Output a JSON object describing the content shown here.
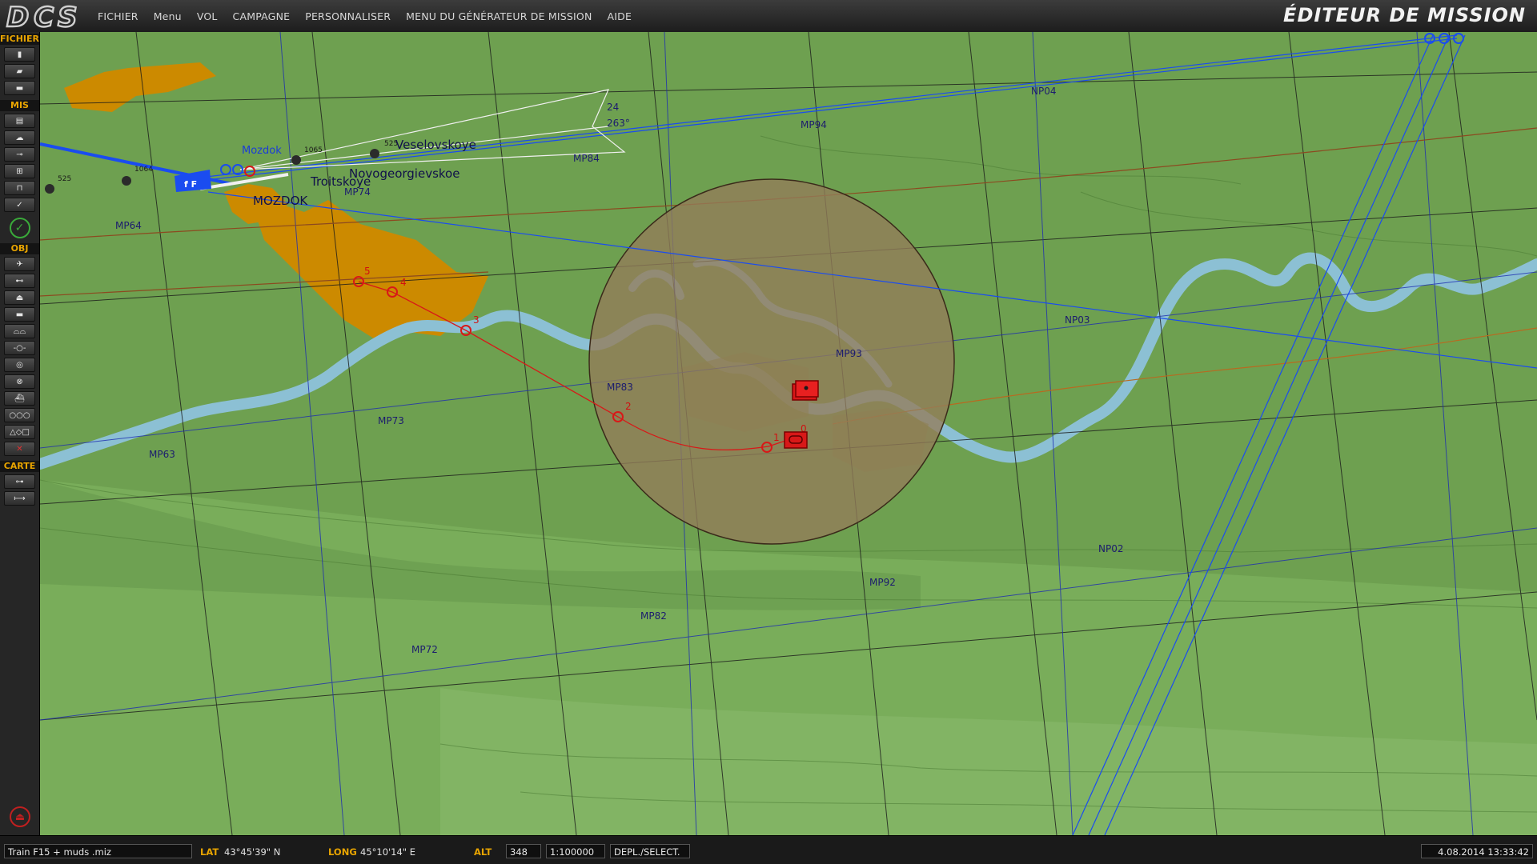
{
  "app": {
    "logo_text": "DCS",
    "title": "ÉDITEUR DE MISSION"
  },
  "menu": {
    "items": [
      {
        "label": "FICHIER"
      },
      {
        "label": "Menu"
      },
      {
        "label": "VOL"
      },
      {
        "label": "CAMPAGNE"
      },
      {
        "label": "PERSONNALISER"
      },
      {
        "label": "MENU DU GÉNÉRATEUR DE MISSION"
      },
      {
        "label": "AIDE"
      }
    ]
  },
  "toolbar": {
    "fichier": "FICHIER",
    "mis": "MIS",
    "obj": "OBJ",
    "carte": "CARTE",
    "fichier_icons": [
      "new-file-icon",
      "open-folder-icon",
      "save-disk-icon"
    ],
    "mis_icons": [
      "briefing-icon",
      "weather-icon",
      "goals-icon",
      "triggers-icon",
      "failures-icon",
      "check-icon"
    ],
    "obj_icons": [
      "plane-icon",
      "helicopter-icon",
      "ship-icon",
      "vehicle-icon",
      "static-icon",
      "waypoint-icon",
      "zone-icon",
      "zoom-icon",
      "naval-icon",
      "template-icon",
      "shapes-icon",
      "delete-icon"
    ],
    "obj_shapes_glyphs": "△◇□",
    "carte_icons": [
      "key-icon",
      "ruler-icon"
    ]
  },
  "map": {
    "grid_labels": [
      {
        "text": "NP04"
      },
      {
        "text": "MP94"
      },
      {
        "text": "MP84"
      },
      {
        "text": "MP74"
      },
      {
        "text": "MP64"
      },
      {
        "text": "NP03"
      },
      {
        "text": "MP93"
      },
      {
        "text": "MP83"
      },
      {
        "text": "MP73"
      },
      {
        "text": "MP63"
      },
      {
        "text": "NP02"
      },
      {
        "text": "MP92"
      },
      {
        "text": "MP82"
      },
      {
        "text": "MP72"
      }
    ],
    "towns": [
      "Veselovskoye",
      "Novogeorgievskoe",
      "Troitskoye",
      "MOZDOK"
    ],
    "airfield": {
      "name": "Mozdok",
      "elevations": [
        "1064",
        "1065",
        "525",
        "525"
      ],
      "runway_info": [
        "24",
        "263°"
      ]
    },
    "waypoints": [
      "0",
      "1",
      "2",
      "3",
      "4",
      "5"
    ],
    "colors": {
      "terrain": "#6ea050",
      "river": "#8cc0d4",
      "town": "#cc8a00",
      "zone": "#947c5a",
      "route": "#d81818",
      "grid": "#20286e",
      "blue_coalition": "#1a4cf0"
    }
  },
  "status": {
    "mission_file": "Train F15 + muds .miz",
    "lat_label": "LAT",
    "lat_value": "43°45'39\" N",
    "long_label": "LONG",
    "long_value": "45°10'14\" E",
    "alt_label": "ALT",
    "alt_value": "348",
    "scale": "1:100000",
    "mode": "DEPL./SELECT.",
    "datetime": "4.08.2014 13:33:42"
  }
}
